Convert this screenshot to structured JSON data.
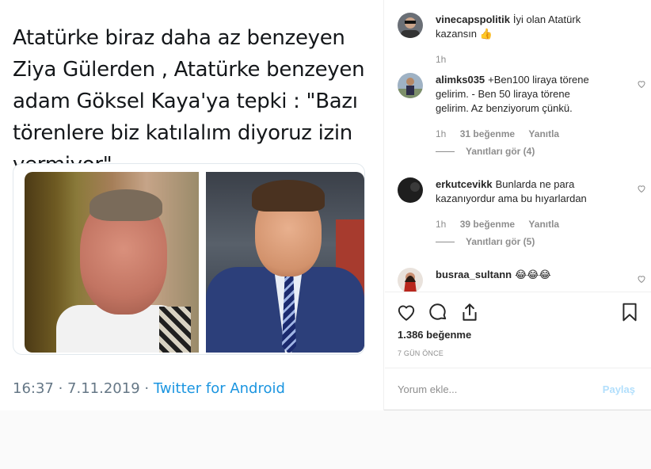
{
  "tweet": {
    "text": "Atatürke biraz daha az benzeyen Ziya Gülerden , Atatürke benzeyen adam Göksel Kaya'ya tepki : \"Bazı törenlere biz katılalım diyoruz izin vermiyor\"...",
    "timestamp": "16:37 · 7.11.2019 · ",
    "source": "Twitter for Android"
  },
  "comments": [
    {
      "user": "vinecapspolitik",
      "text": "İyi olan Atatürk kazansın 👍",
      "time": "1h"
    },
    {
      "user": "alimks035",
      "text": "+Ben100 liraya törene gelirim. - Ben 50 liraya törene gelirim. Az benziyorum çünkü.",
      "time": "1h",
      "likes": "31 beğenme",
      "reply": "Yanıtla",
      "view_replies": "Yanıtları gör (4)"
    },
    {
      "user": "erkutcevikk",
      "text": "Bunlarda ne para kazanıyordur ama bu hıyarlardan",
      "time": "1h",
      "likes": "39 beğenme",
      "reply": "Yanıtla",
      "view_replies": "Yanıtları gör (5)"
    },
    {
      "user": "busraa_sultann",
      "text": "😂😂😂"
    }
  ],
  "actions": {
    "likes": "1.386 beğenme",
    "date": "7 GÜN ÖNCE",
    "icons": [
      "heart-icon",
      "comment-icon",
      "share-icon",
      "bookmark-icon"
    ]
  },
  "add_comment": {
    "placeholder": "Yorum ekle...",
    "post_label": "Paylaş"
  }
}
